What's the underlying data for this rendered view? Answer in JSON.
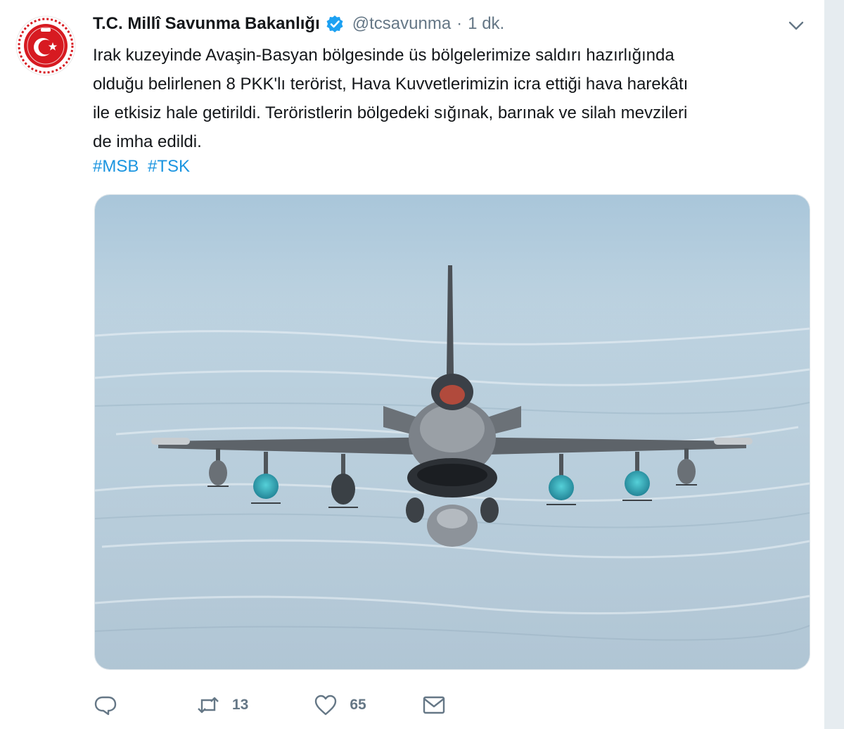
{
  "tweet": {
    "display_name": "T.C. Millî Savunma Bakanlığı",
    "handle": "@tcsavunma",
    "separator": "·",
    "time": "1 dk.",
    "text_lines": [
      "Irak kuzeyinde Avaşin-Basyan bölgesinde üs bölgelerimize saldırı hazırlığında",
      "olduğu belirlenen 8 PKK'lı terörist, Hava Kuvvetlerimizin icra ettiği hava harekâtı",
      "ile etkisiz hale getirildi. Teröristlerin bölgedeki sığınak, barınak ve silah mevzileri",
      "de imha edildi."
    ],
    "hashtags": [
      "#MSB",
      "#TSK"
    ],
    "media_subject": "F-16 fighter jet in flight over snowy terrain"
  },
  "actions": {
    "reply": {
      "icon": "reply-icon"
    },
    "retweet": {
      "icon": "retweet-icon",
      "count": "13"
    },
    "like": {
      "icon": "heart-icon",
      "count": "65"
    },
    "message": {
      "icon": "envelope-icon"
    }
  },
  "colors": {
    "link": "#1b95e0",
    "verified": "#1da1f2",
    "muted": "#657786",
    "logo_red": "#d71a21"
  }
}
